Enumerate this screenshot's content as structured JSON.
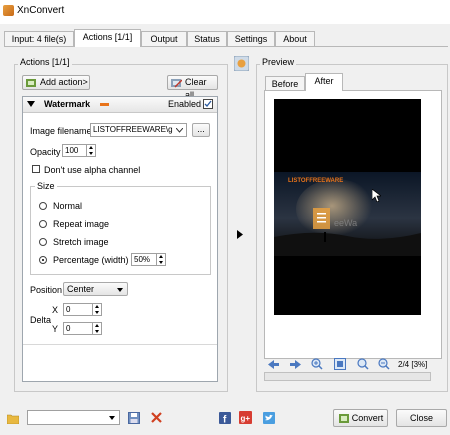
{
  "window": {
    "title": "XnConvert"
  },
  "tabs": [
    "Input: 4 file(s)",
    "Actions [1/1]",
    "Output",
    "Status",
    "Settings",
    "About"
  ],
  "actions": {
    "group_label": "Actions [1/1]",
    "add_action": "Add action>",
    "clear_all": "Clear all",
    "panel": {
      "title": "Watermark",
      "enabled_label": "Enabled",
      "image_filename_label": "Image filename",
      "image_filename_value": "LISTOFFREEWARE\\g",
      "browse_label": "...",
      "opacity_label": "Opacity",
      "opacity_value": "100",
      "alpha_label": "Don't use alpha channel",
      "size_label": "Size",
      "size_options": [
        "Normal",
        "Repeat image",
        "Stretch image",
        "Percentage (width)"
      ],
      "percentage_value": "50%",
      "position_label": "Position",
      "position_value": "Center",
      "delta_label": "Delta",
      "x_label": "X",
      "x_value": "0",
      "y_label": "Y",
      "y_value": "0"
    }
  },
  "preview": {
    "group_label": "Preview",
    "tabs": [
      "Before",
      "After"
    ],
    "watermark_text": "LISTOFFREEWARE",
    "overlay_text": "eeWa",
    "page_info": "2/4 [3%]"
  },
  "footer": {
    "convert": "Convert",
    "close": "Close"
  },
  "colors": {
    "accent_orange": "#e8731a",
    "button_border": "#a9a9a9"
  }
}
